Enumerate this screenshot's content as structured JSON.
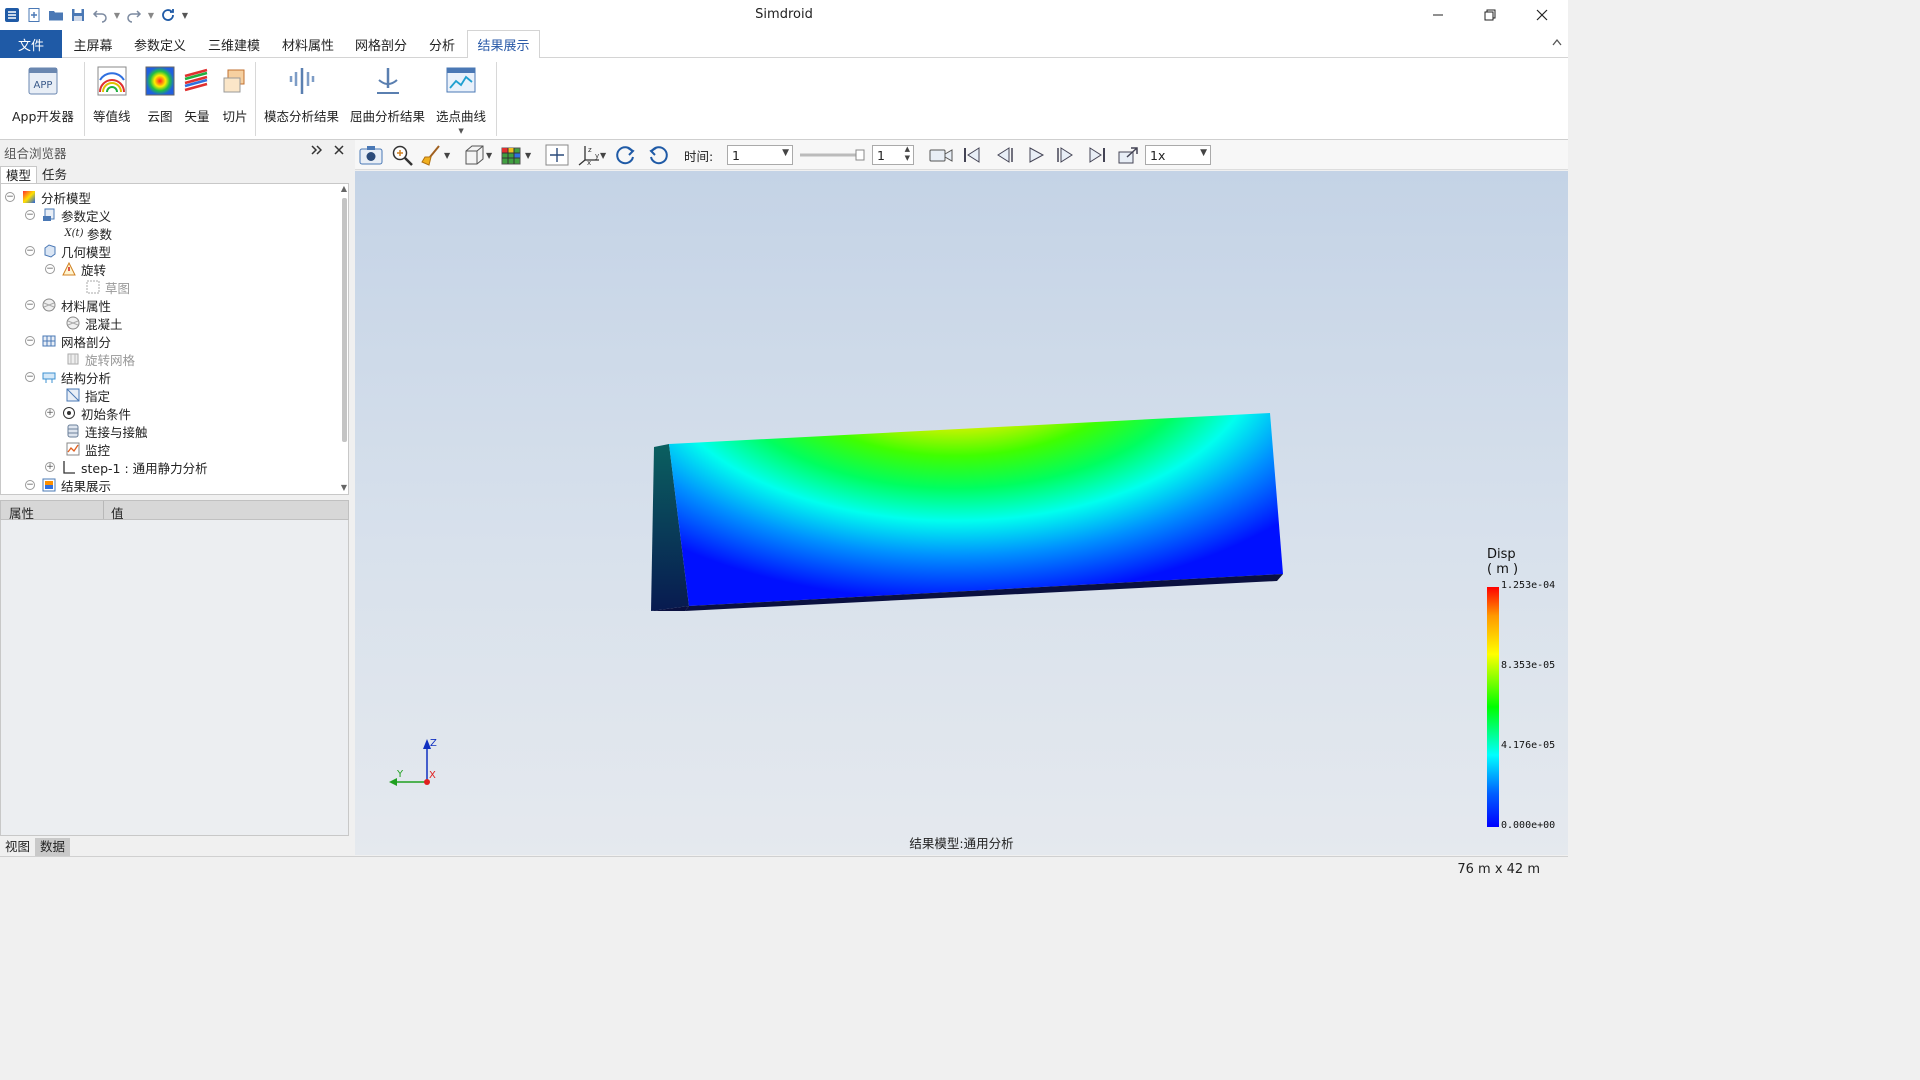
{
  "app": {
    "title": "Simdroid"
  },
  "ribbon_tabs": [
    "文件",
    "主屏幕",
    "参数定义",
    "三维建模",
    "材料属性",
    "网格剖分",
    "分析",
    "结果展示"
  ],
  "ribbon_buttons": {
    "app_dev": "App开发器",
    "app_icon_text": "APP",
    "contour": "等值线",
    "cloud": "云图",
    "vector": "矢量",
    "slice": "切片",
    "modal": "模态分析结果",
    "buckling": "屈曲分析结果",
    "pick_curve": "选点曲线"
  },
  "browser": {
    "title": "组合浏览器",
    "tabs": [
      "模型",
      "任务"
    ],
    "tree": {
      "analysis_model": "分析模型",
      "param_def": "参数定义",
      "param_icon": "X(t)",
      "params": "参数",
      "geometry": "几何模型",
      "revolve": "旋转",
      "sketch": "草图",
      "materials": "材料属性",
      "concrete": "混凝土",
      "meshing": "网格剖分",
      "revolve_mesh": "旋转网格",
      "structural": "结构分析",
      "assign": "指定",
      "initial": "初始条件",
      "contact": "连接与接触",
      "monitor": "监控",
      "step": "step-1 : 通用静力分析",
      "results": "结果展示"
    }
  },
  "properties": {
    "col_property": "属性",
    "col_value": "值"
  },
  "bottom_tabs": [
    "视图",
    "数据"
  ],
  "viewport_toolbar": {
    "time_label": "时间:",
    "time_value": "1",
    "frame_value": "1",
    "speed_value": "1x"
  },
  "legend": {
    "title": "Disp",
    "unit": "( m )",
    "labels": [
      "1.253e-04",
      "8.353e-05",
      "4.176e-05",
      "0.000e+00"
    ]
  },
  "axes": {
    "z": "Z",
    "y": "Y",
    "x": "X"
  },
  "viewport_caption": "结果模型:通用分析",
  "status": {
    "dimensions": "76 m x 42 m"
  },
  "colors": {
    "file_tab": "#1f5aa6",
    "active_tab_text": "#2a5aa8",
    "legend_max": "#ff0000",
    "legend_min": "#0000ff"
  }
}
